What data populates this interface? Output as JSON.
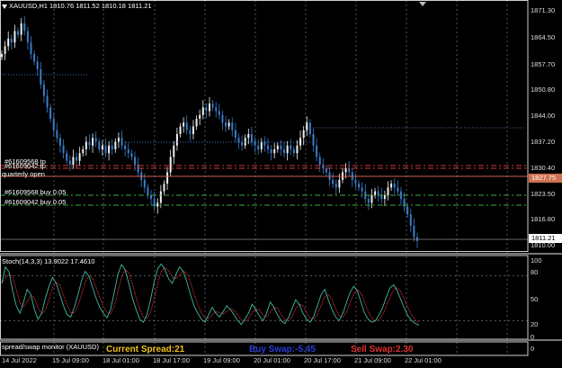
{
  "main_chart": {
    "symbol_info": "XAUUSD,H1  1810.76 1811.52 1810.18 1811.21",
    "price_ticks": [
      "1871.30",
      "1864.50",
      "1857.70",
      "1850.80",
      "1844.00",
      "1837.20",
      "1830.40",
      "1823.50",
      "1816.80",
      "1810.00"
    ],
    "bid_price_label": "1811.21",
    "ask_price_label": "1827.75",
    "order_labels": [
      {
        "text": "#61609568 tp"
      },
      {
        "text": "#61609042 tp"
      },
      {
        "text": "quarterly open"
      },
      {
        "text": "#61609568 buy 0.05"
      },
      {
        "text": "#61609042 buy 0.05"
      }
    ],
    "colors": {
      "bull_candle": "#f0f0f0",
      "bear_candle": "#3a7dc8",
      "tp_line": "#d43a3a",
      "buy_line": "#3faa3f",
      "quarterly_open_line": "#d06050",
      "grid": "#8a8a8a"
    }
  },
  "stoch": {
    "label": "Stoch(14,3,3) 13.9022 17.4610",
    "ticks": [
      "100",
      "80",
      "50",
      "20",
      "0"
    ],
    "main_color": "#3fb8a8",
    "signal_color": "#e03030"
  },
  "monitor": {
    "title": "spread/swap monitor (XAUUSD)",
    "ticks": [
      "0"
    ],
    "current_spread_label": "Current Spread:",
    "current_spread_value": "21",
    "buy_swap_label": "Buy Swap:",
    "buy_swap_value": "-5.45",
    "sell_swap_label": "Sell Swap:",
    "sell_swap_value": "2.30",
    "colors": {
      "spread": "#f0c020",
      "buy": "#2a3ed8",
      "sell": "#e03030"
    }
  },
  "time_axis": {
    "labels": [
      "14 Jul 2022",
      "15 Jul 09:00",
      "18 Jul 01:00",
      "18 Jul 17:00",
      "19 Jul 09:00",
      "20 Jul 01:00",
      "20 Jul 17:00",
      "21 Jul 09:00",
      "22 Jul 01:00"
    ]
  }
}
